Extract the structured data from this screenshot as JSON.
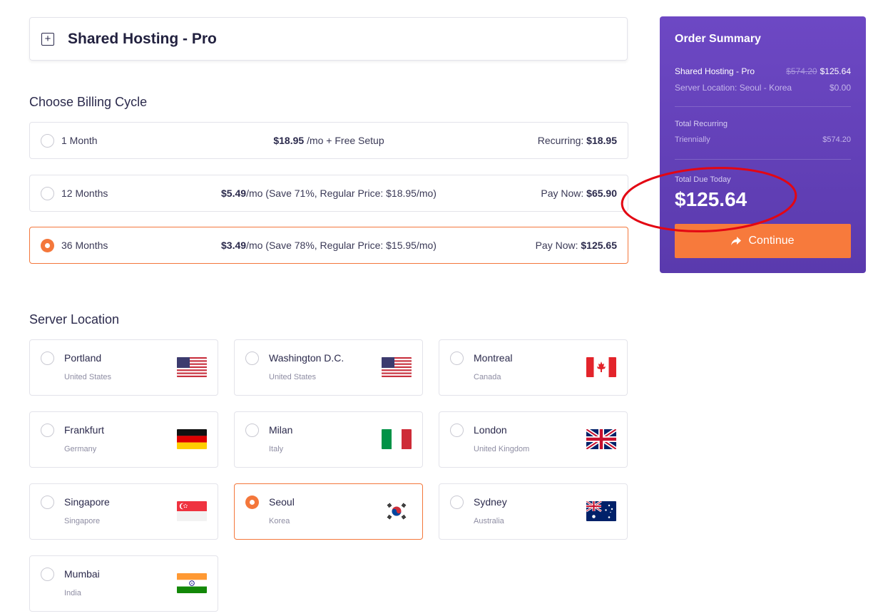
{
  "product": {
    "title": "Shared Hosting - Pro",
    "expand_icon": "plus-square-icon"
  },
  "billing": {
    "heading": "Choose Billing Cycle",
    "options": [
      {
        "term": "1 Month",
        "price": "$18.95",
        "price_suffix": " /mo + Free Setup",
        "right_label": "Recurring: ",
        "right_value": "$18.95",
        "selected": false
      },
      {
        "term": "12 Months",
        "price": "$5.49",
        "price_suffix": "/mo (Save 71%, Regular Price: $18.95/mo)",
        "right_label": "Pay Now: ",
        "right_value": "$65.90",
        "selected": false
      },
      {
        "term": "36 Months",
        "price": "$3.49",
        "price_suffix": "/mo (Save 78%, Regular Price: $15.95/mo)",
        "right_label": "Pay Now: ",
        "right_value": "$125.65",
        "selected": true
      }
    ]
  },
  "locations": {
    "heading": "Server Location",
    "items": [
      {
        "city": "Portland",
        "country": "United States",
        "flag": "us-flag-icon",
        "selected": false
      },
      {
        "city": "Washington D.C.",
        "country": "United States",
        "flag": "us-flag-icon",
        "selected": false
      },
      {
        "city": "Montreal",
        "country": "Canada",
        "flag": "canada-flag-icon",
        "selected": false
      },
      {
        "city": "Frankfurt",
        "country": "Germany",
        "flag": "germany-flag-icon",
        "selected": false
      },
      {
        "city": "Milan",
        "country": "Italy",
        "flag": "italy-flag-icon",
        "selected": false
      },
      {
        "city": "London",
        "country": "United Kingdom",
        "flag": "uk-flag-icon",
        "selected": false
      },
      {
        "city": "Singapore",
        "country": "Singapore",
        "flag": "singapore-flag-icon",
        "selected": false
      },
      {
        "city": "Seoul",
        "country": "Korea",
        "flag": "korea-flag-icon",
        "selected": true
      },
      {
        "city": "Sydney",
        "country": "Australia",
        "flag": "australia-flag-icon",
        "selected": false
      },
      {
        "city": "Mumbai",
        "country": "India",
        "flag": "india-flag-icon",
        "selected": false
      }
    ]
  },
  "summary": {
    "title": "Order Summary",
    "product_name": "Shared Hosting - Pro",
    "product_old_price": "$574.20",
    "product_price": "$125.64",
    "location_label": "Server Location: Seoul - Korea",
    "location_price": "$0.00",
    "recurring_label": "Total Recurring",
    "recurring_cycle": "Triennially",
    "recurring_price": "$574.20",
    "due_label": "Total Due Today",
    "due_amount": "$125.64",
    "continue_label": "Continue",
    "continue_icon": "share-arrow-icon"
  },
  "colors": {
    "accent": "#f4773b",
    "summary_bg": "#6d48c4",
    "annotation": "#e30613"
  }
}
